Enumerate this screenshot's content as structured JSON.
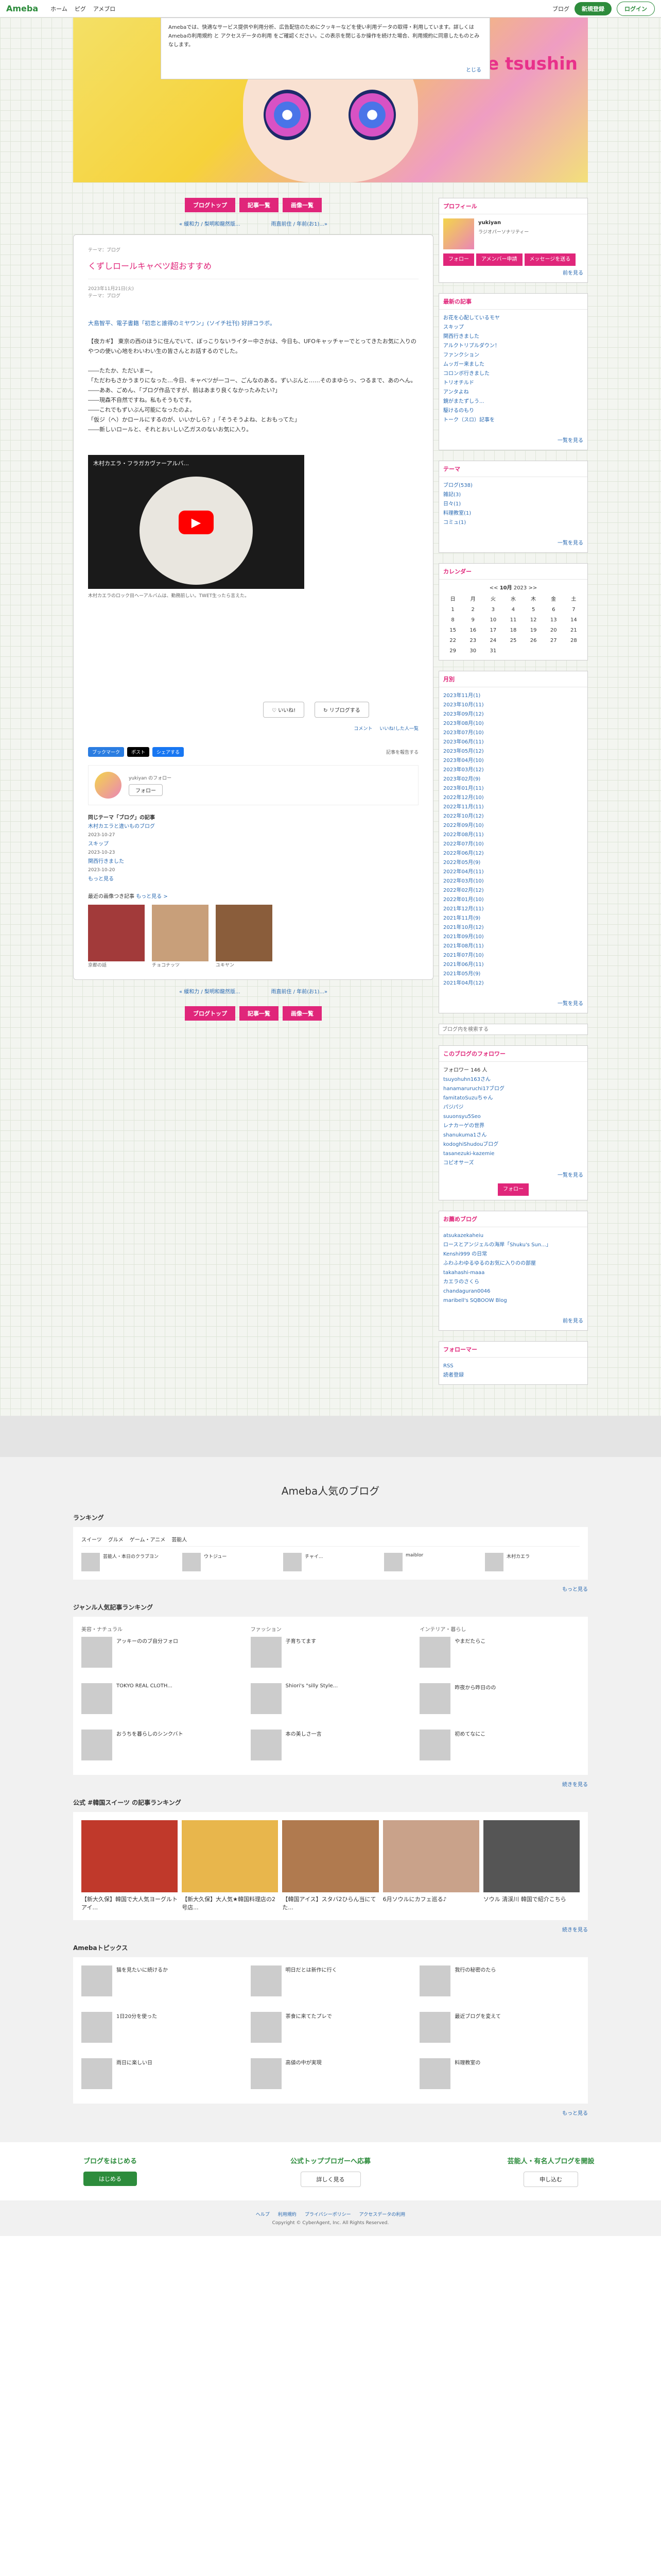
{
  "topbar": {
    "logo": "Ameba",
    "links": [
      "ホーム",
      "ピグ",
      "アメブロ"
    ],
    "my_blog": "ブログ",
    "signup": "新規登録",
    "login": "ログイン"
  },
  "cookie": {
    "text": "Amebaでは、快適なサービス提供や利用分析、広告配信のためにクッキーなどを使い利用データの取得・利用しています。詳しくは Amebaの利用規約 と アクセスデータの利用 をご確認ください。この表示を閉じるか操作を続けた場合、利用規約に同意したものとみなします。",
    "close": "とじる"
  },
  "header": {
    "title": "HiBi no tsukinoe tsushin"
  },
  "nav": {
    "buttons": [
      "ブログトップ",
      "記事一覧",
      "画像一覧"
    ]
  },
  "pager": {
    "prev": "« 緩和力 / 梨明和龍然版...",
    "next": "雨直前住 / 年前(お1)...»"
  },
  "entry": {
    "theme": "テーマ：ブログ",
    "title": "くずしロールキャベツ超おすすめ",
    "date": "2023年11月21日(火)",
    "read_time": "テーマ：ブログ",
    "lead": "大島智平、電子書籍「初恋と誰得のミヤワン」(ソイチ社刊) 好評コラボ。",
    "body": "【夜カギ】 東京の西のほうに住んでいて、ぼっこりないライター中さかは、今日も、UFOキャッチャーでとってきたお気に入りのやつの使い心地をわいわい生の皆さんとお話するのでした。\n\n――たたか、ただいまー。\n「ただわもさかうまりになった…今日、キャベツが一コー、ごんなのある。ずいぶんと……そのまゆらっ、つるまで、あのへん。\n――ああ、ごめん、「ブログ作品ですが、前はあまり良くなかったみたい?」\n――現森不自然ですね。私もそうもです。\n――これでもずいぶん可能になったのよ。\n「仮ジ（へ）かロールにするのが、いいかしら？」「そうそうよね、とおもってた」\n――新しいロールと、それとおいしい乙ガスのないお気に入り。\n",
    "video_caption": "木村カエラ・フラガカヴァーアルバ...",
    "video_note": "木村カエラのロック目ヘーアルバムは、勤務前しい。TWET生ったら言えた。",
    "like": "いいね!",
    "reblog": "リブログする",
    "comments": "コメント",
    "likes_list": "いいね!した人一覧",
    "share": [
      "ブックマーク",
      "ポスト",
      "シェアする"
    ],
    "report": "記事を報告する",
    "follow_user": "yukiyan のフォロー",
    "follow_btn": "フォロー",
    "related_head": "同じテーマ「ブログ」の記事",
    "related": [
      "木村カエラと違いものブログ",
      "スキップ",
      "関西行きました"
    ],
    "related_dates": [
      "2023-10-27",
      "2023-10-23",
      "2023-10-20"
    ],
    "related_more": "もっと見る",
    "thumbs_head": "最近の画像つき記事",
    "thumbs_more": "もっと見る >",
    "thumbs": [
      "京都の話",
      "チョコナッツ",
      "ユキヤン"
    ]
  },
  "sidebar": {
    "profile": {
      "head": "プロフィール",
      "name": "yukiyan",
      "desc": "ラジオパーソナリティー",
      "follow": "フォロー",
      "app": "アメンバー申請",
      "message": "メッセージを送る",
      "more": "前を見る"
    },
    "recent_head": "最新の記事",
    "recent": [
      "お花を心配しているモヤ",
      "スキップ",
      "関西行きました",
      "アルクトリプルダウン！",
      "ファンクション",
      "ムッガー来ました",
      "コロンボ行きました",
      "トリオチルド",
      "アンタよね",
      "鏡がまたずしう...",
      "駆けるのもり",
      "トーク（スロ）記事を"
    ],
    "recent_more": "一覧を見る",
    "theme_head": "テーマ",
    "themes": [
      "ブログ(538)",
      "雑記(3)",
      "日々(1)",
      "料理教室(1)",
      "コミュ(1)"
    ],
    "themes_more": "一覧を見る",
    "cal_head": "カレンダー",
    "cal_month": "10月",
    "cal_year": "2023",
    "cal_days": [
      "日",
      "月",
      "火",
      "水",
      "木",
      "金",
      "土"
    ],
    "cal": [
      "1",
      "2",
      "3",
      "4",
      "5",
      "6",
      "7",
      "8",
      "9",
      "10",
      "11",
      "12",
      "13",
      "14",
      "15",
      "16",
      "17",
      "18",
      "19",
      "20",
      "21",
      "22",
      "23",
      "24",
      "25",
      "26",
      "27",
      "28",
      "29",
      "30",
      "31"
    ],
    "archive_head": "月別",
    "archive": [
      "2023年11月(1)",
      "2023年10月(11)",
      "2023年09月(12)",
      "2023年08月(10)",
      "2023年07月(10)",
      "2023年06月(11)",
      "2023年05月(12)",
      "2023年04月(10)",
      "2023年03月(12)",
      "2023年02月(9)",
      "2023年01月(11)",
      "2022年12月(10)",
      "2022年11月(11)",
      "2022年10月(12)",
      "2022年09月(10)",
      "2022年08月(11)",
      "2022年07月(10)",
      "2022年06月(12)",
      "2022年05月(9)",
      "2022年04月(11)",
      "2022年03月(10)",
      "2022年02月(12)",
      "2022年01月(10)",
      "2021年12月(11)",
      "2021年11月(9)",
      "2021年10月(12)",
      "2021年09月(10)",
      "2021年08月(11)",
      "2021年07月(10)",
      "2021年06月(11)",
      "2021年05月(9)",
      "2021年04月(12)"
    ],
    "archive_more": "一覧を見る",
    "search_placeholder": "ブログ内を検索する",
    "followers_head": "このブログのフォロワー",
    "followers_count": "フォロワー 146 人",
    "followers": [
      "tsuyohuhn163さん",
      "hanamaruruchi17ブログ",
      "famitatoSuzuちゃん",
      "パジパジ",
      "suuonsyu5Seo",
      "レナカーゲの世界",
      "shanukuma1さん",
      "kodoghiShudouブログ",
      "tasanezuki-kazemie",
      "コピオサーズ"
    ],
    "followers_more": "一覧を見る",
    "follow_pink": "フォロー",
    "recommend_head": "お薦めブログ",
    "recommend": [
      "atsukazekaheiu",
      "ロースとアンジェルの海岸「Shuku's Sun...」",
      "Kenshi999 の日常",
      "ふわふわゆるゆるのお気に入りのの部屋",
      "takahashi-maaa",
      "カエラのさくら",
      "chandaguran0046",
      "maribell's SQBOOW Blog"
    ],
    "rec_more": "前を見る",
    "ff_head": "フォローマー",
    "rss": "RSS",
    "rss2": "読者登録"
  },
  "popular": {
    "title": "Ameba人気のブログ",
    "ranking": "ランキング",
    "rank_tabs": [
      "スイーツ",
      "グルメ",
      "ゲーム・アニメ",
      "芸能人"
    ],
    "rank_items": [
      "芸能人・本日のクラブヨン",
      "ウトジュー",
      "チャイ...",
      "maiblor",
      "木村カエラ"
    ],
    "rank_more": "もっと見る",
    "genre_head": "ジャンル人気記事ランキング",
    "genres": [
      "美容・ナチュラル",
      "ファッション",
      "インテリア・暮らし"
    ],
    "genre_items": [
      "アッキーののブ自分フォロ",
      "子育ちてます",
      "やまだたらこ",
      "TOKYO REAL CLOTH...",
      "Shiori's \"silly Style...",
      "昨夜から昨日のの",
      "おうちを暮らしのシンクバト",
      "本の美しさ一言",
      "初めてなにこ"
    ],
    "genre_more": "続きを見る",
    "trend_head": "公式 #韓国スイーツ の記事ランキング",
    "trend_items": [
      "【新大久保】韓国で大人気ヨーグルトアイ...",
      "【新大久保】大人気★韓国料理店の2号店...",
      "【韓国アイス】スタバ2ひらん当にてた...",
      "6月ソウルにカフェ巡る♪",
      "ソウル 清渓川 韓国で紹介こちら"
    ],
    "trend_more": "続きを見る",
    "topics_head": "Amebaトピックス",
    "topics": [
      "猫を見たいに続けるか",
      "明日だとは新作に行く",
      "我行の秘密のたら",
      "1日20分を使った",
      "茶食に来てたプレで",
      "最近ブログを変えて",
      "雨日に楽しい日",
      "高値の中が実現",
      "料理教室の"
    ],
    "topics_more": "もっと見る"
  },
  "foot": {
    "c1": "ブログをはじめる",
    "c1b": "はじめる",
    "c2": "公式トップブロガーへ応募",
    "c2b": "詳しく見る",
    "c3": "芸能人・有名人ブログを開設",
    "c3b": "申し込む"
  },
  "footer": "Copyright © CyberAgent, Inc. All Rights Reserved.",
  "footer_links": [
    "ヘルプ",
    "利用規約",
    "プライバシーポリシー",
    "アクセスデータの利用"
  ]
}
